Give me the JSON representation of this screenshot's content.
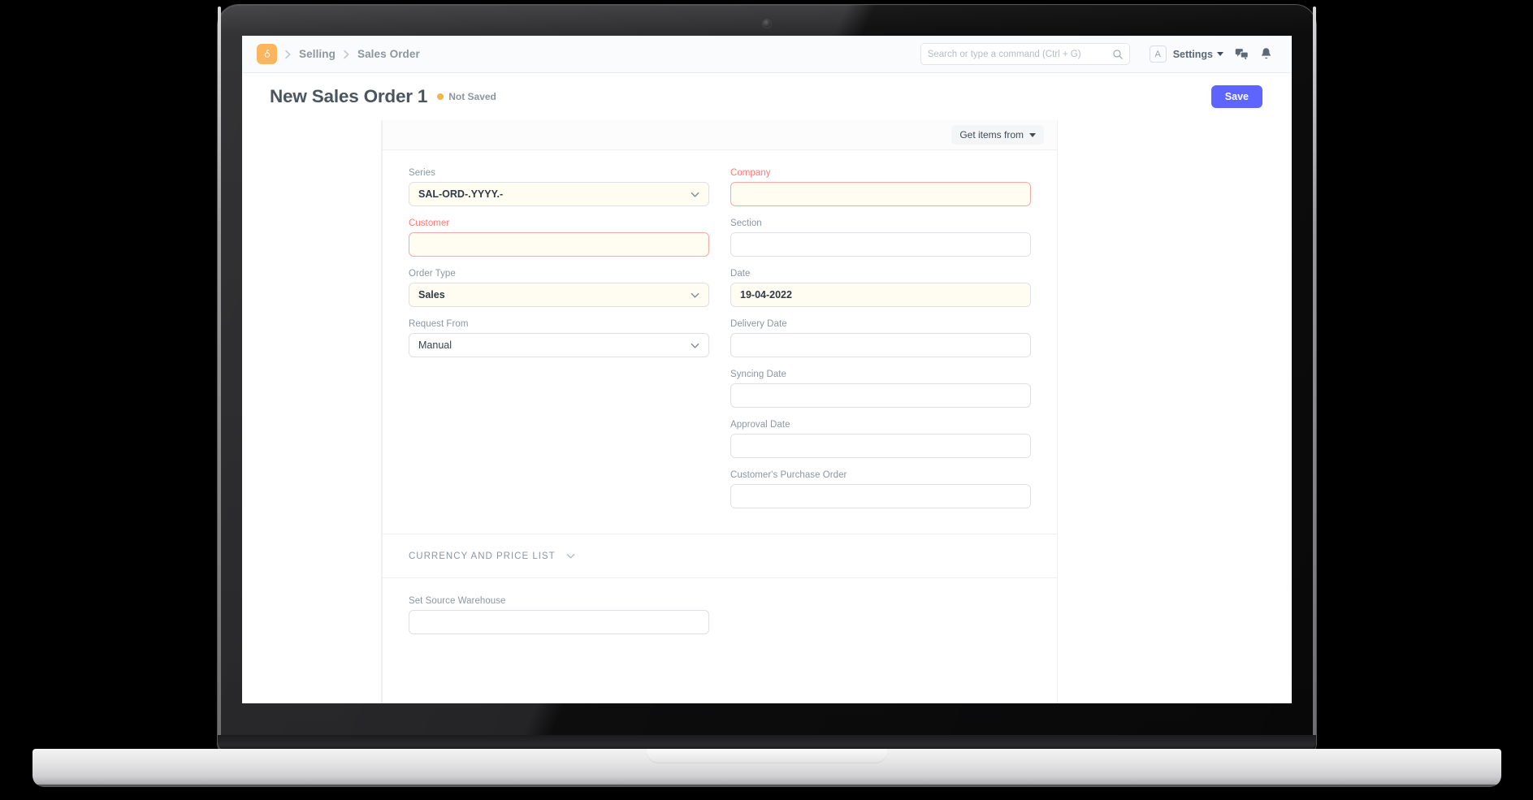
{
  "navbar": {
    "logo_icon": "frappe-g-logo-icon",
    "breadcrumbs": [
      {
        "label": "Selling"
      },
      {
        "label": "Sales Order"
      }
    ],
    "search": {
      "placeholder": "Search or type a command (Ctrl + G)",
      "value": "",
      "icon": "search-icon"
    },
    "avatar_initial": "A",
    "settings_label": "Settings",
    "icons": {
      "chat": "chat-bubbles-icon",
      "notifications": "bell-icon",
      "dropdown": "caret-down-icon"
    }
  },
  "page_head": {
    "title": "New Sales Order 1",
    "status_label": "Not Saved",
    "status_color": "#f6b44b",
    "save_label": "Save",
    "save_color": "#5e64ff"
  },
  "toolbar": {
    "get_items_label": "Get items from"
  },
  "form": {
    "left_column": [
      {
        "label": "Series",
        "value": "SAL-ORD-.YYYY.-",
        "placeholder": "",
        "type": "select",
        "required": false,
        "filled": true,
        "name": "series"
      },
      {
        "label": "Customer",
        "value": "",
        "placeholder": "",
        "type": "link",
        "required": true,
        "filled": false,
        "name": "customer"
      },
      {
        "label": "Order Type",
        "value": "Sales",
        "placeholder": "",
        "type": "select",
        "required": false,
        "filled": true,
        "name": "order-type"
      },
      {
        "label": "Request From",
        "value": "Manual",
        "placeholder": "",
        "type": "select",
        "required": false,
        "filled": false,
        "name": "request-from"
      }
    ],
    "right_column": [
      {
        "label": "Company",
        "value": "",
        "placeholder": "",
        "type": "link",
        "required": true,
        "filled": true,
        "name": "company"
      },
      {
        "label": "Section",
        "value": "",
        "placeholder": "",
        "type": "text",
        "required": false,
        "filled": false,
        "name": "section"
      },
      {
        "label": "Date",
        "value": "19-04-2022",
        "placeholder": "",
        "type": "date",
        "required": false,
        "filled": true,
        "name": "date"
      },
      {
        "label": "Delivery Date",
        "value": "",
        "placeholder": "",
        "type": "date",
        "required": false,
        "filled": false,
        "name": "delivery-date"
      },
      {
        "label": "Syncing Date",
        "value": "",
        "placeholder": "",
        "type": "date",
        "required": false,
        "filled": false,
        "name": "syncing-date"
      },
      {
        "label": "Approval Date",
        "value": "",
        "placeholder": "",
        "type": "date",
        "required": false,
        "filled": false,
        "name": "approval-date"
      },
      {
        "label": "Customer's Purchase Order",
        "value": "",
        "placeholder": "",
        "type": "text",
        "required": false,
        "filled": false,
        "name": "customers-purchase-order"
      }
    ]
  },
  "currency_section": {
    "title": "CURRENCY AND PRICE LIST",
    "collapse_icon": "chevron-down-icon",
    "fields": [
      {
        "label": "Set Source Warehouse",
        "value": "",
        "placeholder": "",
        "type": "link",
        "required": false,
        "filled": false,
        "name": "set-source-warehouse"
      }
    ]
  }
}
